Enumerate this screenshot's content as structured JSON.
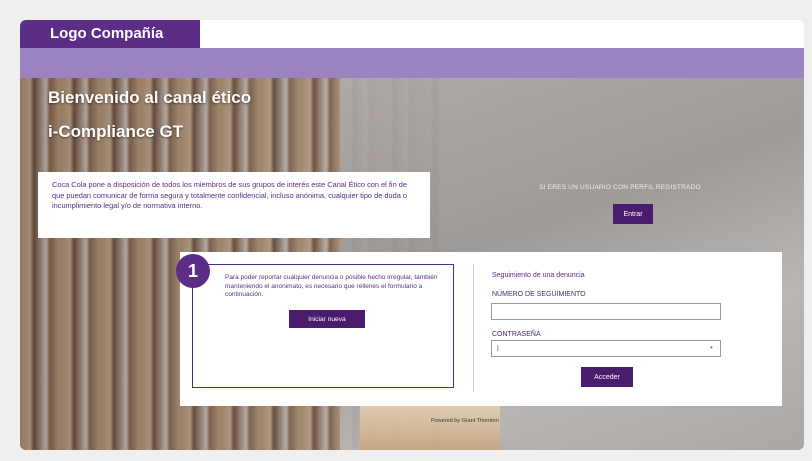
{
  "header": {
    "logo_text": "Logo Compañía"
  },
  "hero": {
    "title_line1": "Bienvenido al canal ético",
    "title_line2": "i-Compliance GT",
    "intro_text": "Coca Cola pone a disposición de todos los miembros de sus grupos de interés este Canal Ético con el fin de que puedan comunicar de forma segura y totalmente confidencial, incluso anónima, cualquier tipo de duda o incumplimiento legal y/o de normativa interno."
  },
  "login_area": {
    "registered_text": "SI ERES UN USUARIO CON PERFIL REGISTRADO",
    "enter_button": "Entrar"
  },
  "report": {
    "badge_number": "1",
    "description": "Para poder reportar cualquier denuncia o posible hecho irregular, también manteniendo el anonimato, es necesario que rellenes el formulario a continuación.",
    "new_report_button": "Iniciar nueva denuncia"
  },
  "tracking": {
    "section_title": "Seguimiento de una denuncia",
    "tracking_number_label": "NÚMERO DE SEGUIMIENTO",
    "tracking_number_value": "",
    "password_label": "CONTRASEÑA",
    "password_value": "|",
    "access_button": "Acceder"
  },
  "footer": {
    "powered_text": "Powered by Grant Thornton"
  },
  "colors": {
    "brand_purple": "#5b2d86",
    "button_purple": "#4a1c6e",
    "bar_lavender": "#9b82c0"
  }
}
